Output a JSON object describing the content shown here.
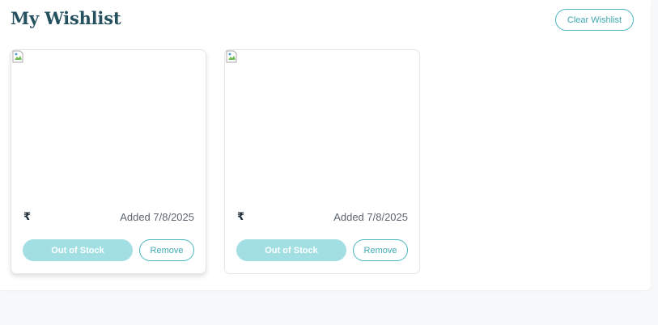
{
  "header": {
    "title": "My Wishlist",
    "clear_label": "Clear Wishlist"
  },
  "items": [
    {
      "image_icon": "broken-image-icon",
      "price_symbol": "₹",
      "added": "Added 7/8/2025",
      "stock_label": "Out of Stock",
      "remove_label": "Remove"
    },
    {
      "image_icon": "broken-image-icon",
      "price_symbol": "₹",
      "added": "Added 7/8/2025",
      "stock_label": "Out of Stock",
      "remove_label": "Remove"
    }
  ],
  "colors": {
    "title": "#25515f",
    "accent": "#4ab5bd",
    "disabled_button": "#a2dfe3",
    "page_background": "#f7f8fa"
  }
}
